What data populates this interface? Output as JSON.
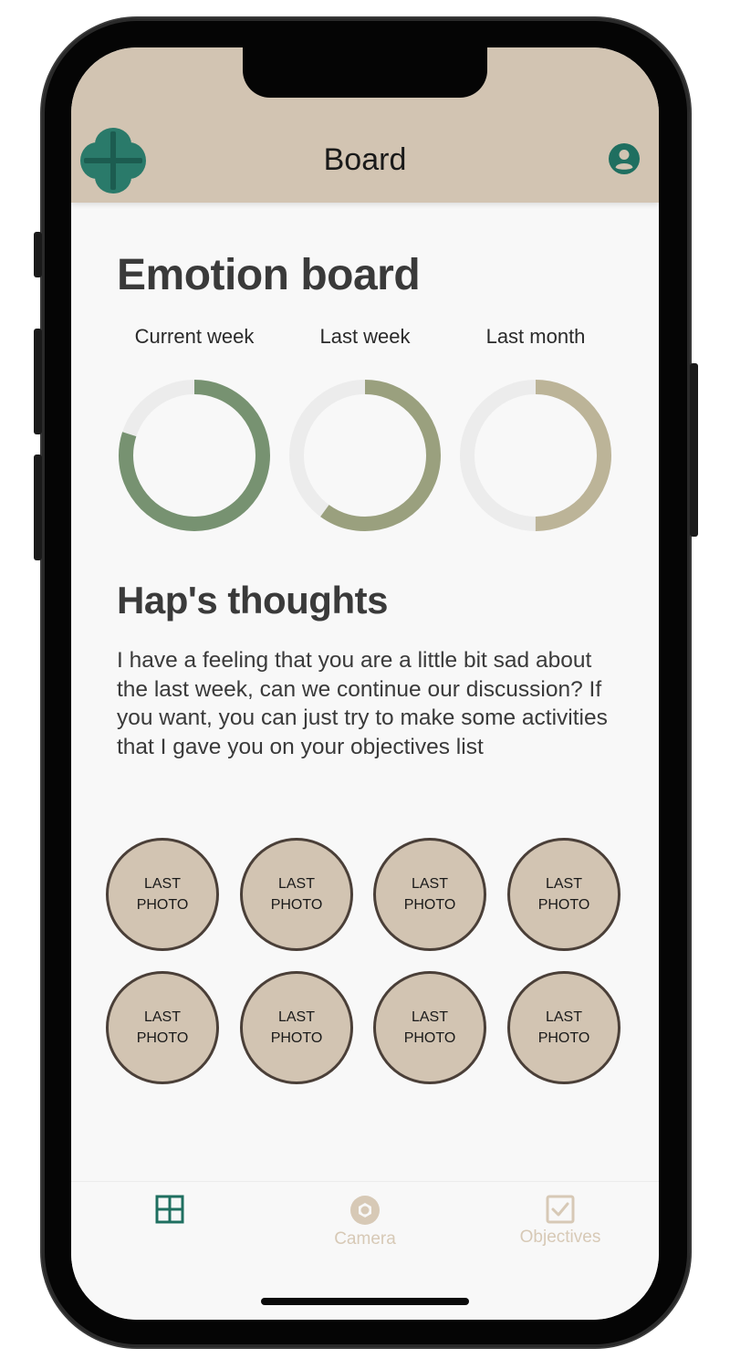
{
  "header": {
    "title": "Board",
    "logo_icon": "clover-icon",
    "profile_icon": "account-circle-icon",
    "background": "#d2c4b2",
    "accent": "#1f6f60"
  },
  "emotion_board": {
    "title": "Emotion board",
    "charts": [
      {
        "label": "Current week",
        "fill_fraction": 0.8,
        "color": "#779271"
      },
      {
        "label": "Last week",
        "fill_fraction": 0.6,
        "color": "#9aa07e"
      },
      {
        "label": "Last month",
        "fill_fraction": 0.5,
        "color": "#bcb498"
      }
    ],
    "track_color": "#ececec"
  },
  "thoughts": {
    "title": "Hap's thoughts",
    "text": "I have a feeling that you are a little bit sad about the last week, can we continue our discussion? If you want, you can just try to make some activities that I gave you on your objectives list"
  },
  "photos": [
    {
      "label": "LAST\nPHOTO"
    },
    {
      "label": "LAST\nPHOTO"
    },
    {
      "label": "LAST\nPHOTO"
    },
    {
      "label": "LAST\nPHOTO"
    },
    {
      "label": "LAST\nPHOTO"
    },
    {
      "label": "LAST\nPHOTO"
    },
    {
      "label": "LAST\nPHOTO"
    },
    {
      "label": "LAST\nPHOTO"
    }
  ],
  "tabs": [
    {
      "label": "",
      "icon": "grid-icon",
      "active": true
    },
    {
      "label": "Camera",
      "icon": "camera-shutter-icon",
      "active": false
    },
    {
      "label": "Objectives",
      "icon": "checkbox-icon",
      "active": false
    }
  ]
}
